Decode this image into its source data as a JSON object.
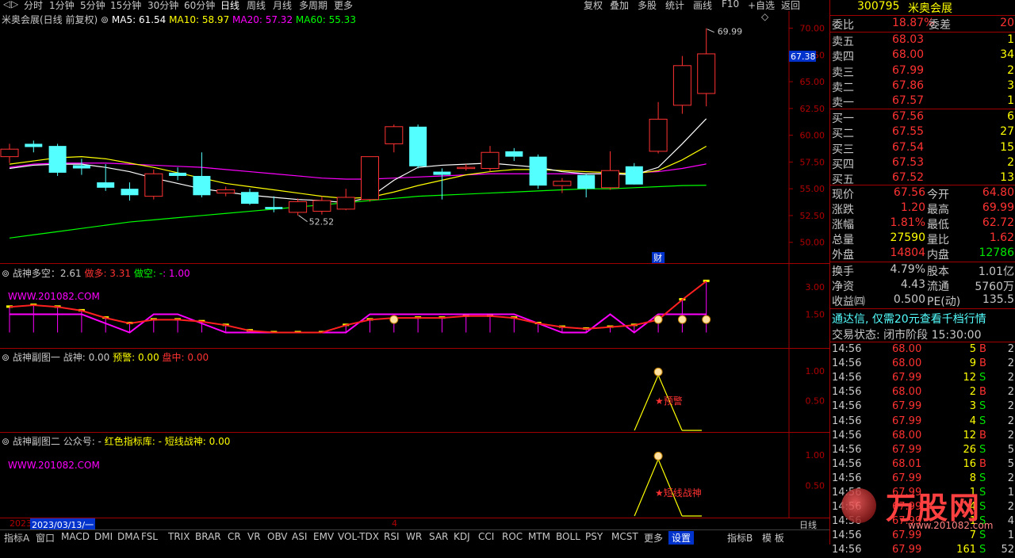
{
  "topmenu": {
    "periods": [
      "分时",
      "1分钟",
      "5分钟",
      "15分钟",
      "30分钟",
      "60分钟",
      "日线",
      "周线",
      "月线",
      "多周期",
      "更多"
    ],
    "active": "日线",
    "right": [
      "复权",
      "叠加",
      "多股",
      "统计",
      "画线",
      "F10",
      "+自选",
      "返回"
    ]
  },
  "main_chart": {
    "title": "米奥会展(日线 前复权)",
    "ma5": "MA5: 61.54",
    "ma10": "MA10: 58.97",
    "ma20": "MA20: 57.32",
    "ma60": "MA60: 55.33",
    "high_label": "69.99",
    "low_label": "52.52",
    "current_price_tag": "67.38",
    "cai_tag": "财",
    "y_ticks": [
      "70.00",
      "67.50",
      "65.00",
      "62.50",
      "60.00",
      "57.50",
      "55.00",
      "52.50",
      "50.00"
    ],
    "colors": {
      "ma5": "#ffffff",
      "ma10": "#ffff00",
      "ma20": "#ff00ff",
      "ma60": "#00ff00",
      "up": "#ff3232",
      "down": "#54ffff"
    }
  },
  "chart_data": {
    "type": "candlestick",
    "title": "米奥会展(日线 前复权)",
    "candles": [
      {
        "o": 58.0,
        "c": 58.7,
        "h": 59.2,
        "l": 57.4
      },
      {
        "o": 59.2,
        "c": 58.9,
        "h": 59.5,
        "l": 58.4
      },
      {
        "o": 59.0,
        "c": 56.5,
        "h": 59.2,
        "l": 56.2
      },
      {
        "o": 57.2,
        "c": 56.9,
        "h": 57.8,
        "l": 56.3
      },
      {
        "o": 55.6,
        "c": 55.1,
        "h": 57.3,
        "l": 54.8
      },
      {
        "o": 55.0,
        "c": 54.4,
        "h": 55.6,
        "l": 53.9
      },
      {
        "o": 54.3,
        "c": 56.4,
        "h": 56.8,
        "l": 54.0
      },
      {
        "o": 56.5,
        "c": 56.2,
        "h": 57.0,
        "l": 55.8
      },
      {
        "o": 56.2,
        "c": 54.4,
        "h": 58.4,
        "l": 54.2
      },
      {
        "o": 54.6,
        "c": 54.9,
        "h": 55.2,
        "l": 54.3
      },
      {
        "o": 54.7,
        "c": 53.6,
        "h": 55.0,
        "l": 53.5
      },
      {
        "o": 53.3,
        "c": 53.1,
        "h": 54.3,
        "l": 52.8
      },
      {
        "o": 52.8,
        "c": 53.8,
        "h": 54.1,
        "l": 52.5
      },
      {
        "o": 52.9,
        "c": 53.9,
        "h": 54.3,
        "l": 52.6
      },
      {
        "o": 53.1,
        "c": 54.2,
        "h": 55.0,
        "l": 53.0
      },
      {
        "o": 54.0,
        "c": 58.0,
        "h": 58.0,
        "l": 53.8
      },
      {
        "o": 59.2,
        "c": 60.8,
        "h": 61.0,
        "l": 58.4
      },
      {
        "o": 60.8,
        "c": 57.1,
        "h": 61.0,
        "l": 56.9
      },
      {
        "o": 56.6,
        "c": 56.3,
        "h": 56.9,
        "l": 54.0
      },
      {
        "o": 56.9,
        "c": 57.0,
        "h": 57.3,
        "l": 56.7
      },
      {
        "o": 56.9,
        "c": 58.4,
        "h": 59.0,
        "l": 56.6
      },
      {
        "o": 58.5,
        "c": 58.0,
        "h": 58.8,
        "l": 57.6
      },
      {
        "o": 58.0,
        "c": 55.3,
        "h": 58.2,
        "l": 55.0
      },
      {
        "o": 55.3,
        "c": 55.7,
        "h": 56.0,
        "l": 54.6
      },
      {
        "o": 56.3,
        "c": 55.0,
        "h": 56.4,
        "l": 54.2
      },
      {
        "o": 55.1,
        "c": 56.7,
        "h": 58.5,
        "l": 54.9
      },
      {
        "o": 57.1,
        "c": 55.4,
        "h": 57.4,
        "l": 55.4
      },
      {
        "o": 58.5,
        "c": 61.5,
        "h": 63.1,
        "l": 58.3
      },
      {
        "o": 62.8,
        "c": 66.5,
        "h": 67.4,
        "l": 62.0
      },
      {
        "o": 63.9,
        "c": 67.6,
        "h": 69.99,
        "l": 62.7
      }
    ],
    "ma5": [
      56.9,
      57.2,
      57.3,
      57.3,
      57.0,
      56.6,
      56.0,
      55.5,
      55.0,
      54.7,
      54.4,
      54.2,
      54.0,
      53.9,
      53.7,
      54.2,
      55.8,
      57.0,
      57.2,
      57.3,
      57.4,
      57.2,
      57.0,
      56.6,
      56.4,
      56.4,
      56.3,
      57.0,
      59.2,
      61.54
    ],
    "ma10": [
      57.3,
      57.6,
      57.9,
      58.0,
      57.8,
      57.4,
      57.0,
      56.5,
      56.0,
      55.5,
      55.2,
      54.9,
      54.6,
      54.3,
      54.1,
      54.2,
      54.7,
      55.3,
      55.8,
      56.3,
      56.6,
      56.8,
      56.8,
      56.7,
      56.6,
      56.5,
      56.4,
      56.7,
      57.7,
      58.97
    ],
    "ma20": [
      57.0,
      57.3,
      57.4,
      57.4,
      57.4,
      57.3,
      57.2,
      57.1,
      57.0,
      56.8,
      56.6,
      56.4,
      56.2,
      56.0,
      55.9,
      55.9,
      56.0,
      56.1,
      56.2,
      56.3,
      56.4,
      56.4,
      56.4,
      56.4,
      56.4,
      56.4,
      56.5,
      56.6,
      56.9,
      57.32
    ],
    "ma60": [
      50.4,
      50.7,
      51.0,
      51.3,
      51.6,
      51.9,
      52.1,
      52.3,
      52.5,
      52.7,
      52.9,
      53.1,
      53.3,
      53.5,
      53.7,
      53.9,
      54.1,
      54.3,
      54.4,
      54.5,
      54.6,
      54.7,
      54.8,
      54.9,
      55.0,
      55.0,
      55.1,
      55.2,
      55.3,
      55.33
    ],
    "ylim": [
      48.5,
      71.0
    ],
    "y_ticks": [
      70.0,
      67.5,
      65.0,
      62.5,
      60.0,
      57.5,
      55.0,
      52.5,
      50.0
    ]
  },
  "ind1": {
    "title": "战神多空：2.61",
    "zuoduo": "做多: 3.31",
    "zuokong": "做空: -",
    "zuokong_val": ": 1.00",
    "watermark": "WWW.201082.COM",
    "y_ticks": [
      "3.00",
      "1.50"
    ],
    "line_red": [
      1.9,
      2.0,
      1.9,
      1.7,
      1.3,
      1.0,
      1.2,
      1.2,
      1.1,
      0.9,
      0.6,
      0.5,
      0.5,
      0.5,
      0.9,
      1.2,
      1.3,
      1.3,
      1.3,
      1.4,
      1.4,
      1.3,
      1.0,
      0.8,
      0.7,
      0.8,
      0.9,
      1.2,
      2.3,
      3.31
    ],
    "line_magenta": [
      1.5,
      1.5,
      1.5,
      1.5,
      1.0,
      0.5,
      1.5,
      1.5,
      1.0,
      0.5,
      0.5,
      0.5,
      0.5,
      0.5,
      0.5,
      1.5,
      1.5,
      1.5,
      1.5,
      1.5,
      1.5,
      1.5,
      1.0,
      0.5,
      0.5,
      1.5,
      0.5,
      1.5,
      1.5,
      1.5
    ]
  },
  "ind2": {
    "title": "战神副图一 战神: 0.00",
    "yujing": "预警: 0.00",
    "panzhong": "盘中: 0.00",
    "alert_label": "预警",
    "y_ticks": [
      "1.00",
      "0.50"
    ]
  },
  "ind3": {
    "title": "战神副图二 公众号: -",
    "lib": "红色指标库: -",
    "dxzs": "短线战神: 0.00",
    "watermark": "WWW.201082.COM",
    "alert_label": "短线战神",
    "y_ticks": [
      "1.00",
      "0.50"
    ],
    "date_labels": [
      "2023",
      "2023/03/13/一",
      "4"
    ]
  },
  "bottombar": {
    "tabs": [
      "指标A",
      "窗口",
      "MACD",
      "DMI",
      "DMA",
      "FSL",
      "TRIX",
      "BRAR",
      "CR",
      "VR",
      "OBV",
      "ASI",
      "EMV",
      "VOL-TDX",
      "RSI",
      "WR",
      "SAR",
      "KDJ",
      "CCI",
      "ROC",
      "MTM",
      "BOLL",
      "PSY",
      "MCST",
      "更多",
      "设置"
    ],
    "right_tabs": [
      "指标B",
      "模 板"
    ],
    "period": "日线"
  },
  "quote": {
    "code": "300795",
    "name": "米奥会展",
    "weibi_label": "委比",
    "weibi": "18.87%",
    "weicha_label": "委差",
    "weicha": "20",
    "sells": [
      {
        "label": "卖五",
        "price": "68.03",
        "vol": "1"
      },
      {
        "label": "卖四",
        "price": "68.00",
        "vol": "34"
      },
      {
        "label": "卖三",
        "price": "67.99",
        "vol": "2"
      },
      {
        "label": "卖二",
        "price": "67.86",
        "vol": "3"
      },
      {
        "label": "卖一",
        "price": "67.57",
        "vol": "1"
      }
    ],
    "buys": [
      {
        "label": "买一",
        "price": "67.56",
        "vol": "6"
      },
      {
        "label": "买二",
        "price": "67.55",
        "vol": "27"
      },
      {
        "label": "买三",
        "price": "67.54",
        "vol": "15"
      },
      {
        "label": "买四",
        "price": "67.53",
        "vol": "2"
      },
      {
        "label": "买五",
        "price": "67.52",
        "vol": "13"
      }
    ],
    "stats": [
      {
        "l1": "现价",
        "v1": "67.56",
        "l2": "今开",
        "v2": "64.80"
      },
      {
        "l1": "涨跌",
        "v1": "1.20",
        "l2": "最高",
        "v2": "69.99"
      },
      {
        "l1": "涨幅",
        "v1": "1.81%",
        "l2": "最低",
        "v2": "62.72"
      },
      {
        "l1": "总量",
        "v1": "27590",
        "l2": "量比",
        "v2": "1.62"
      },
      {
        "l1": "外盘",
        "v1": "14804",
        "l2": "内盘",
        "v2": "12786"
      }
    ],
    "stats2": [
      {
        "l1": "换手",
        "v1": "4.79%",
        "l2": "股本",
        "v2": "1.01亿"
      },
      {
        "l1": "净资",
        "v1": "4.43",
        "l2": "流通",
        "v2": "5760万"
      },
      {
        "l1": "收益㈣",
        "v1": "0.500",
        "l2": "PE(动)",
        "v2": "135.5"
      }
    ],
    "promo": "通达信, 仅需20元查看千档行情",
    "status": "交易状态: 闭市阶段 15:30:00",
    "ticks": [
      {
        "t": "14:56",
        "p": "68.00",
        "v": "5",
        "s": "B",
        "n": "2"
      },
      {
        "t": "14:56",
        "p": "68.00",
        "v": "9",
        "s": "B",
        "n": "2"
      },
      {
        "t": "14:56",
        "p": "67.99",
        "v": "12",
        "s": "S",
        "n": "2"
      },
      {
        "t": "14:56",
        "p": "68.00",
        "v": "2",
        "s": "B",
        "n": "2"
      },
      {
        "t": "14:56",
        "p": "67.99",
        "v": "3",
        "s": "S",
        "n": "2"
      },
      {
        "t": "14:56",
        "p": "67.99",
        "v": "4",
        "s": "S",
        "n": "2"
      },
      {
        "t": "14:56",
        "p": "68.00",
        "v": "12",
        "s": "B",
        "n": "2"
      },
      {
        "t": "14:56",
        "p": "67.99",
        "v": "26",
        "s": "S",
        "n": "5"
      },
      {
        "t": "14:56",
        "p": "68.01",
        "v": "16",
        "s": "B",
        "n": "5"
      },
      {
        "t": "14:56",
        "p": "67.99",
        "v": "8",
        "s": "S",
        "n": "2"
      },
      {
        "t": "14:56",
        "p": "67.99",
        "v": "1",
        "s": "S",
        "n": "1"
      },
      {
        "t": "14:56",
        "p": "67.99",
        "v": "4",
        "s": "S",
        "n": "2"
      },
      {
        "t": "14:56",
        "p": "67.99",
        "v": "1",
        "s": "S",
        "n": "4"
      },
      {
        "t": "14:56",
        "p": "67.99",
        "v": "7",
        "s": "S",
        "n": "1"
      },
      {
        "t": "14:56",
        "p": "67.99",
        "v": "161",
        "s": "S",
        "n": "52"
      }
    ],
    "logo_text": "万股网",
    "logo_url": "www.201082.com",
    "colors": {
      "up": "#ff3232",
      "down": "#00e600",
      "vol": "#ffff00",
      "label": "#c8c8c8"
    }
  }
}
